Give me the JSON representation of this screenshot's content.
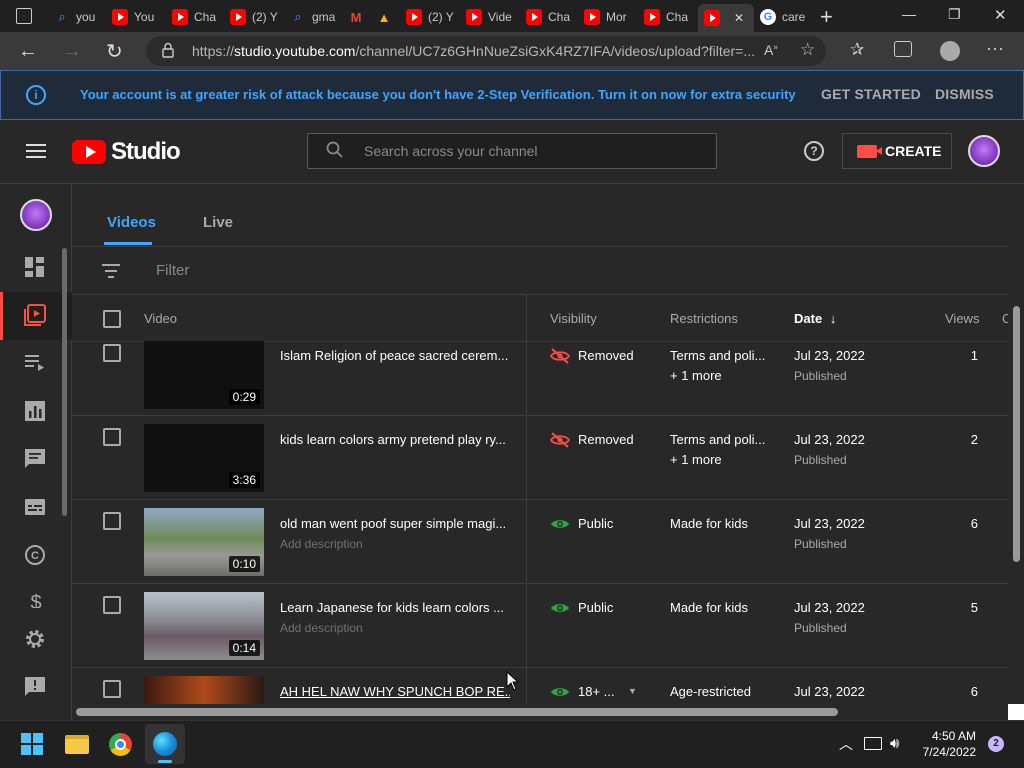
{
  "browser": {
    "tabs": [
      {
        "label": "you",
        "icon": "search-icon"
      },
      {
        "label": "You",
        "icon": "youtube-icon"
      },
      {
        "label": "Cha",
        "icon": "youtube-icon"
      },
      {
        "label": "(2) Y",
        "icon": "youtube-icon"
      },
      {
        "label": "gma",
        "icon": "search-icon"
      },
      {
        "label": "",
        "icon": "gmail-icon"
      },
      {
        "label": "",
        "icon": "drive-icon"
      },
      {
        "label": "(2) Y",
        "icon": "youtube-icon"
      },
      {
        "label": "Vide",
        "icon": "youtube-icon"
      },
      {
        "label": "Cha",
        "icon": "youtube-icon"
      },
      {
        "label": "Mor",
        "icon": "youtube-icon"
      },
      {
        "label": "Cha",
        "icon": "youtube-icon"
      },
      {
        "label": "",
        "icon": "youtube-icon",
        "active": true
      },
      {
        "label": "care",
        "icon": "google-icon"
      }
    ],
    "url_prefix": "https://",
    "url_host": "studio.youtube.com",
    "url_path": "/channel/UC7z6GHnNueZsiGxK4RZ7IFA/videos/upload?filter=...",
    "window_controls": {
      "minimize": "—",
      "maximize": "❐",
      "close": "✕"
    }
  },
  "banner": {
    "message": "Your account is at greater risk of attack because you don't have 2-Step Verification. Turn it on now for extra security",
    "get_started": "GET STARTED",
    "dismiss": "DISMISS"
  },
  "header": {
    "logo_text": "Studio",
    "search_placeholder": "Search across your channel",
    "create_label": "CREATE"
  },
  "content": {
    "tabs": [
      {
        "label": "Videos",
        "active": true
      },
      {
        "label": "Live"
      }
    ],
    "filter_placeholder": "Filter",
    "columns": {
      "video": "Video",
      "visibility": "Visibility",
      "restrictions": "Restrictions",
      "date": "Date",
      "views": "Views",
      "comments": "C"
    },
    "rows": [
      {
        "title": "Islam Religion of peace sacred cerem...",
        "description": "",
        "duration": "0:29",
        "visibility": "Removed",
        "restriction": "Terms and poli...",
        "restriction_more": "+ 1 more",
        "date": "Jul 23, 2022",
        "date_status": "Published",
        "views": "1"
      },
      {
        "title": "kids learn colors army pretend play ry...",
        "description": "",
        "duration": "3:36",
        "visibility": "Removed",
        "restriction": "Terms and poli...",
        "restriction_more": "+ 1 more",
        "date": "Jul 23, 2022",
        "date_status": "Published",
        "views": "2"
      },
      {
        "title": "old man went poof super simple magi...",
        "description": "Add description",
        "duration": "0:10",
        "visibility": "Public",
        "restriction": "Made for kids",
        "restriction_more": "",
        "date": "Jul 23, 2022",
        "date_status": "Published",
        "views": "6"
      },
      {
        "title": "Learn Japanese for kids learn colors ...",
        "description": "Add description",
        "duration": "0:14",
        "visibility": "Public",
        "restriction": "Made for kids",
        "restriction_more": "",
        "date": "Jul 23, 2022",
        "date_status": "Published",
        "views": "5"
      },
      {
        "title": "AH HEL NAW WHY SPUNCH BOP RE...",
        "description": "",
        "duration": "",
        "visibility": "18+ ...",
        "restriction": "Age-restricted",
        "restriction_more": "",
        "date": "Jul 23, 2022",
        "date_status": "",
        "views": "6"
      }
    ]
  },
  "taskbar": {
    "time": "4:50 AM",
    "date": "7/24/2022",
    "notification_count": "2"
  },
  "colors": {
    "accent_blue": "#3ea6ff",
    "removed_red": "#ff4e45",
    "public_green": "#2ba640",
    "youtube_red": "#ff0000"
  }
}
